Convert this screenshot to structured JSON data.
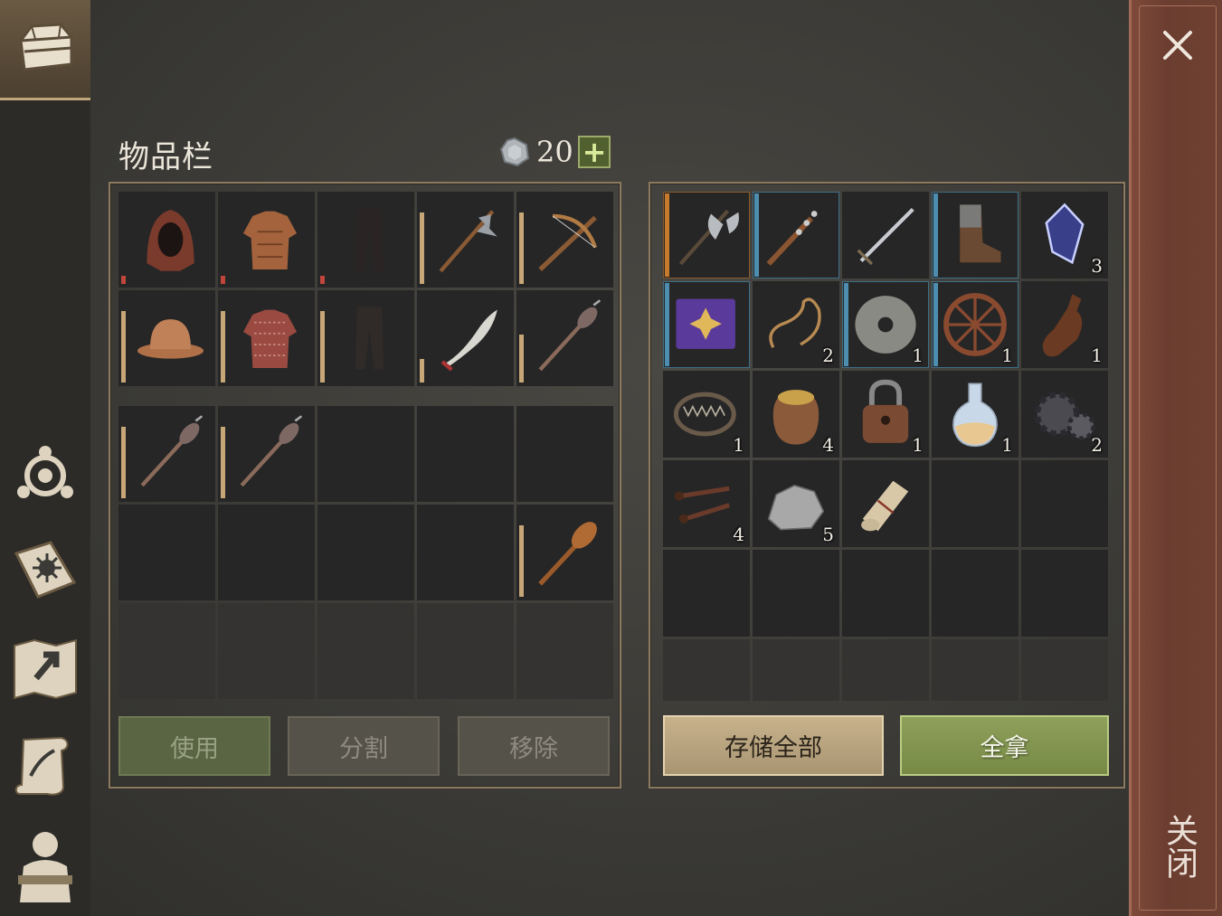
{
  "title": "物品栏",
  "currency": {
    "count": "20",
    "add_label": "+"
  },
  "close_label": "关闭",
  "buttons": {
    "use": "使用",
    "split": "分割",
    "remove": "移除",
    "store_all": "存储全部",
    "take_all": "全拿"
  },
  "sidebar_icons": [
    "chest-icon",
    "skills-icon",
    "quest-book-icon",
    "map-icon",
    "scroll-icon",
    "character-icon"
  ],
  "equipped_items": [
    {
      "name": "hood",
      "durability": 0.1
    },
    {
      "name": "padded-armor",
      "durability": 0.1
    },
    {
      "name": "pants",
      "durability": 0.1
    },
    {
      "name": "halberd",
      "durability": 0.9
    },
    {
      "name": "crossbow",
      "durability": 0.9
    },
    {
      "name": "kettle-helmet",
      "durability": 0.9
    },
    {
      "name": "chainmail",
      "durability": 0.9
    },
    {
      "name": "leather-pants",
      "durability": 0.9
    },
    {
      "name": "scimitar",
      "durability": 0.3
    },
    {
      "name": "mace",
      "durability": 0.6
    }
  ],
  "bag_items": [
    {
      "name": "mace",
      "durability": 0.9
    },
    {
      "name": "mace",
      "durability": 0.9
    },
    null,
    null,
    null,
    null,
    null,
    null,
    null,
    {
      "name": "wooden-club",
      "durability": 0.9
    }
  ],
  "storage_items": [
    {
      "name": "battle-axe",
      "qty": "",
      "frame": "orange"
    },
    {
      "name": "spiked-club",
      "qty": "",
      "frame": "blue"
    },
    {
      "name": "longsword",
      "qty": "",
      "frame": "none"
    },
    {
      "name": "boots",
      "qty": "",
      "frame": "blue"
    },
    {
      "name": "crystal",
      "qty": "3",
      "frame": "none"
    },
    {
      "name": "spell-book",
      "qty": "",
      "frame": "blue"
    },
    {
      "name": "rope",
      "qty": "2",
      "frame": "none"
    },
    {
      "name": "millstone",
      "qty": "1",
      "frame": "blue"
    },
    {
      "name": "wheel",
      "qty": "1",
      "frame": "blue"
    },
    {
      "name": "bottle",
      "qty": "1",
      "frame": "none"
    },
    {
      "name": "bear-trap",
      "qty": "1",
      "frame": "none"
    },
    {
      "name": "grain-sack",
      "qty": "4",
      "frame": "none"
    },
    {
      "name": "padlock",
      "qty": "1",
      "frame": "none"
    },
    {
      "name": "potion",
      "qty": "1",
      "frame": "none"
    },
    {
      "name": "gears",
      "qty": "2",
      "frame": "none"
    },
    {
      "name": "nails",
      "qty": "4",
      "frame": "none"
    },
    {
      "name": "stone",
      "qty": "5",
      "frame": "none"
    },
    {
      "name": "scroll-roll",
      "qty": "",
      "frame": "none"
    }
  ],
  "colors": {
    "accent_gold": "#c7a777",
    "durability_low": "#c0463b",
    "rarity_orange": "#c77a2c",
    "rarity_blue": "#4d8eb0"
  }
}
